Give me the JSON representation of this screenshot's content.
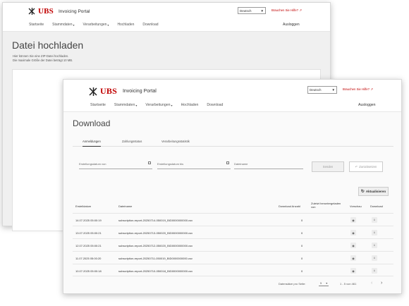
{
  "brand": {
    "logo_text": "UBS",
    "portal_name": "Invoicing Portal"
  },
  "header": {
    "language": "Deutsch",
    "help_link": "Brauchen Sie Hilfe?",
    "nav": [
      "Startseite",
      "Stammdaten",
      "Verarbeitungen",
      "Hochladen",
      "Download"
    ],
    "logout": "Ausloggen"
  },
  "back_page": {
    "title": "Datei hochladen",
    "info_line1": "Hier können Sie eine ZIP-Datei hochladen.",
    "info_line2": "Die maximale Größe der Datei beträgt 10 MB."
  },
  "download_page": {
    "title": "Download",
    "tabs": [
      "Anmeldungen",
      "Zahlungsstatus",
      "Verarbeitungsstatistik"
    ],
    "filters": {
      "date_from": "Erstellungsdatum von",
      "date_to": "Erstellungsdatum bis",
      "filename": "Dateiname"
    },
    "send_button": "Senden",
    "reset_button": "Zurücksetzen",
    "refresh_button": "Aktualisieren",
    "columns": {
      "created": "Erstelldatum",
      "filename": "Dateiname",
      "download_count": "Download Anzahl",
      "last_downloaded_line1": "Zuletzt heruntergeladen",
      "last_downloaded_line2": "von",
      "preview": "Vorschau",
      "download": "Download"
    },
    "rows": [
      {
        "created": "14.07.2025 05:00:19",
        "filename": "subscription-report-20250714-050019_BID0000000000.csv",
        "count": "0"
      },
      {
        "created": "13.07.2025 05:00:21",
        "filename": "subscription-report-20250713-050020_BID0000000000.csv",
        "count": "0"
      },
      {
        "created": "12.07.2025 05:00:21",
        "filename": "subscription-report-20250712-050020_BID0000000000.csv",
        "count": "0"
      },
      {
        "created": "11.07.2025 05:00:20",
        "filename": "subscription-report-20250711-050019_BID0000000000.csv",
        "count": "0"
      },
      {
        "created": "10.07.2025 05:00:18",
        "filename": "subscription-report-20250710-050018_BID0000000000.csv",
        "count": "0"
      }
    ],
    "pagination": {
      "per_page_label": "Datensätze pro Seite:",
      "per_page": "5",
      "range": "1 - 5 von 461"
    }
  },
  "colors": {
    "brand_red": "#c00000"
  }
}
